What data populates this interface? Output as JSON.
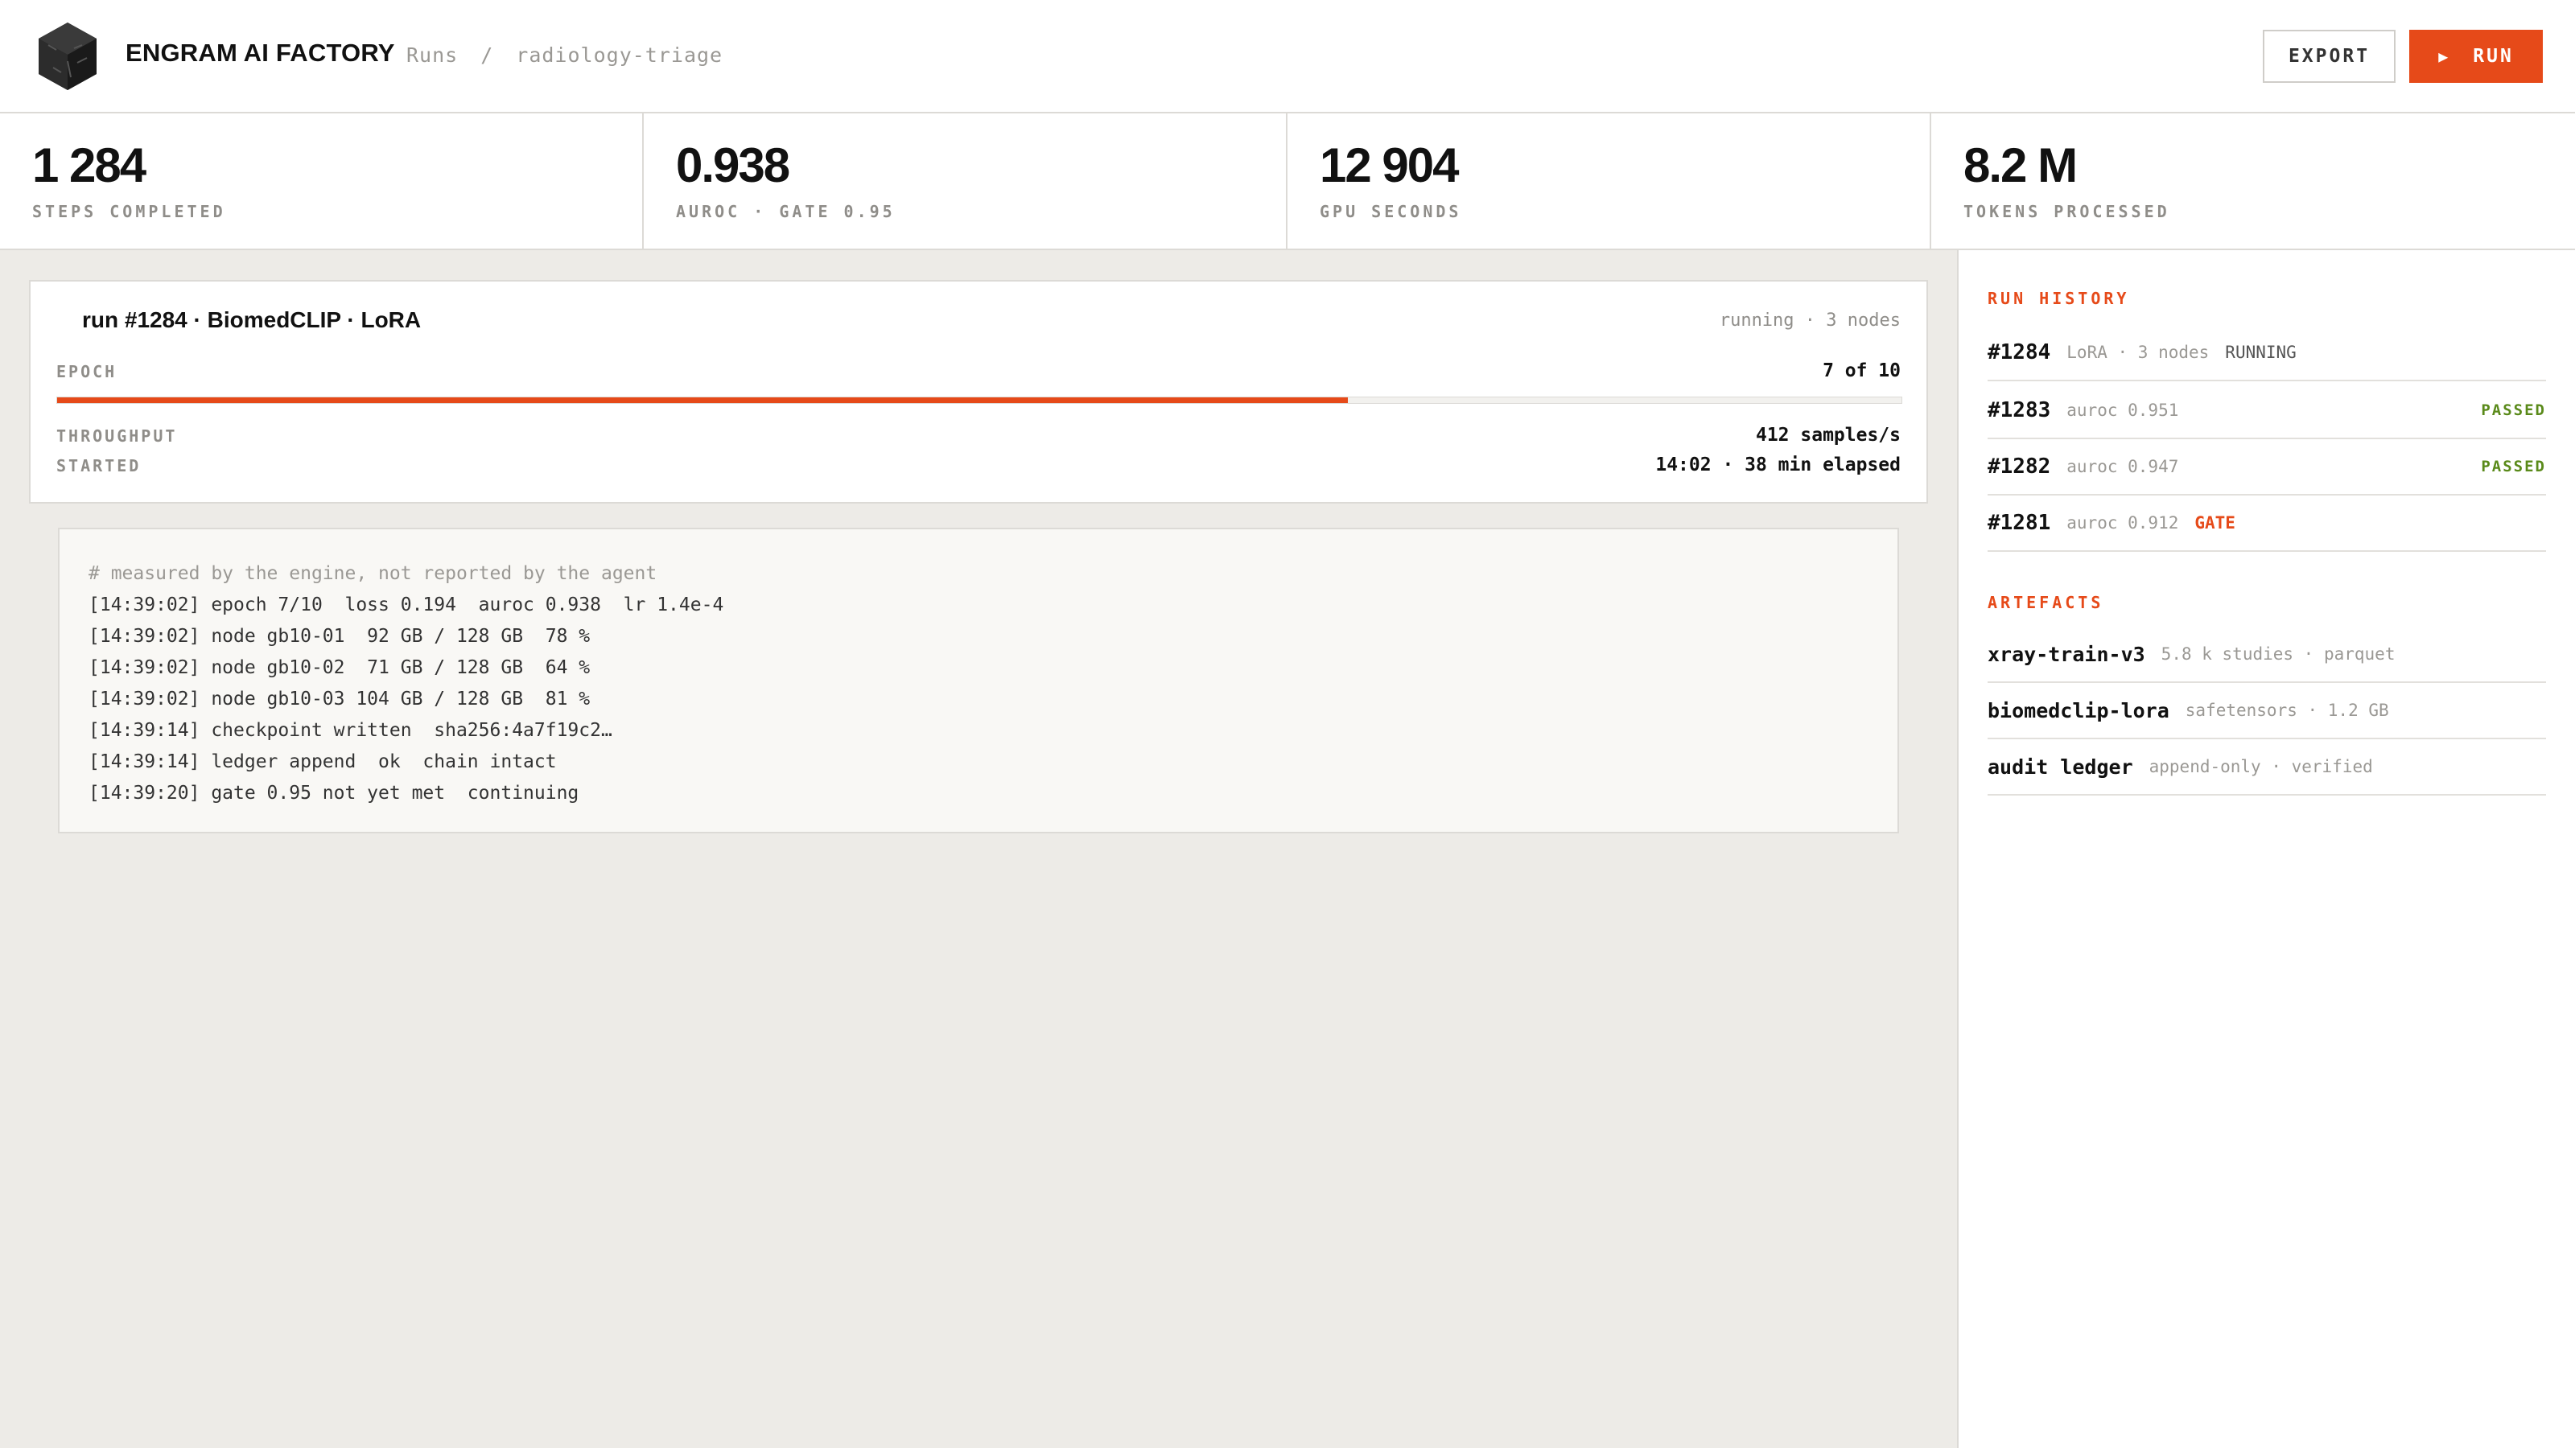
{
  "header": {
    "brand": "ENGRAM AI FACTORY",
    "breadcrumb": [
      "Runs",
      "radiology-triage"
    ],
    "breadcrumb_sep": "/",
    "export_label": "EXPORT",
    "run_icon": "▶",
    "run_label": "RUN"
  },
  "stats": [
    {
      "value": "1 284",
      "label": "STEPS COMPLETED"
    },
    {
      "value": "0.938",
      "label": "AUROC · GATE 0.95"
    },
    {
      "value": "12 904",
      "label": "GPU SECONDS"
    },
    {
      "value": "8.2 M",
      "label": "TOKENS PROCESSED"
    }
  ],
  "run": {
    "title": "run #1284 · BiomedCLIP · LoRA",
    "status": "running · 3 nodes",
    "epoch_label": "EPOCH",
    "epoch_value": "7 of 10",
    "epoch_progress": 0.7,
    "throughput_label": "THROUGHPUT",
    "throughput_value": "412 samples/s",
    "started_label": "STARTED",
    "started_value": "14:02 · 38 min elapsed"
  },
  "log": {
    "comment": "# measured by the engine, not reported by the agent",
    "lines": [
      "[14:39:02] epoch 7/10  loss 0.194  auroc 0.938  lr 1.4e-4",
      "[14:39:02] node gb10-01  92 GB / 128 GB  78 %",
      "[14:39:02] node gb10-02  71 GB / 128 GB  64 %",
      "[14:39:02] node gb10-03 104 GB / 128 GB  81 %",
      "[14:39:14] checkpoint written  sha256:4a7f19c2…",
      "[14:39:14] ledger append  ok  chain intact",
      "[14:39:20] gate 0.95 not yet met  continuing"
    ]
  },
  "sidebar": {
    "history_heading": "RUN HISTORY",
    "history": [
      {
        "id": "#1284",
        "meta": "LoRA · 3 nodes",
        "state": "RUNNING",
        "badge": ""
      },
      {
        "id": "#1283",
        "meta": "auroc 0.951",
        "state": "",
        "badge": "PASSED"
      },
      {
        "id": "#1282",
        "meta": "auroc 0.947",
        "state": "",
        "badge": "PASSED"
      },
      {
        "id": "#1281",
        "meta": "auroc 0.912",
        "state": "GATE",
        "badge": ""
      }
    ],
    "artefacts_heading": "ARTEFACTS",
    "artefacts": [
      {
        "name": "xray-train-v3",
        "meta": "5.8 k studies · parquet"
      },
      {
        "name": "biomedclip-lora",
        "meta": "safetensors · 1.2 GB"
      },
      {
        "name": "audit ledger",
        "meta": "append-only · verified"
      }
    ]
  },
  "colors": {
    "accent": "#e64a19",
    "passed": "#5a8a1a"
  },
  "icons": {
    "logo": "cube-logo-icon",
    "run": "play-icon"
  }
}
